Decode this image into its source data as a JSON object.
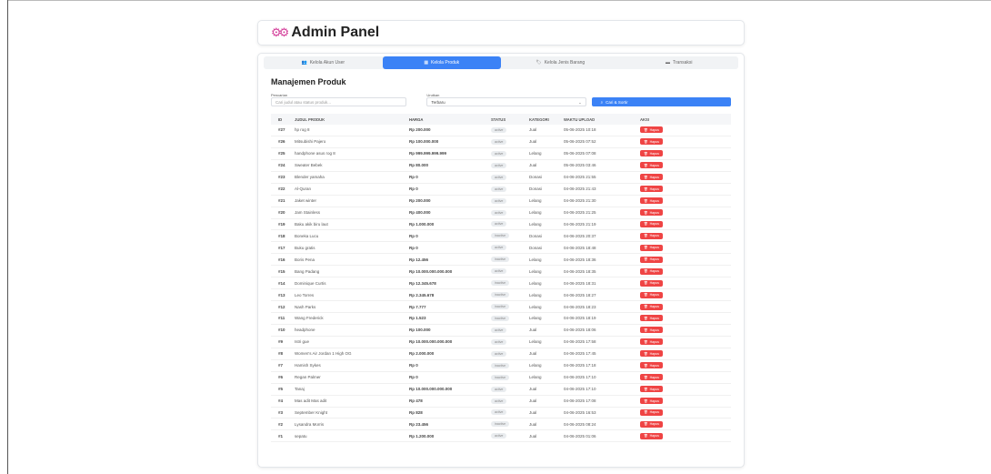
{
  "app": {
    "title": "Admin Panel",
    "icon": "gears-icon",
    "accent_color": "#3b82f6",
    "danger_color": "#ef4444"
  },
  "tabs": [
    {
      "label": "Kelola Akun User",
      "icon": "users-icon",
      "active": false
    },
    {
      "label": "Kelola Produk",
      "icon": "box-icon",
      "active": true
    },
    {
      "label": "Kelola Jenis Barang",
      "icon": "tags-icon",
      "active": false
    },
    {
      "label": "Transaksi",
      "icon": "card-icon",
      "active": false
    }
  ],
  "section_title": "Manajemen Produk",
  "filters": {
    "search_label": "Pencarian",
    "search_placeholder": "Cari judul atau status produk...",
    "sort_label": "Urutkan",
    "sort_value": "Terbaru",
    "submit_label": "Cari & Sortir"
  },
  "table": {
    "headers": [
      "ID",
      "JUDUL PRODUK",
      "HARGA",
      "STATUS",
      "KATEGORI",
      "WAKTU UPLOAD",
      "AKSI"
    ],
    "delete_label": "Hapus",
    "rows": [
      {
        "id": "#27",
        "title": "hp rog 8",
        "price": "Rp 200.000",
        "status": "active",
        "category": "Jual",
        "time": "05-06-2025 10:18"
      },
      {
        "id": "#26",
        "title": "Mitsubishi Pajero",
        "price": "Rp 100.000.000",
        "status": "active",
        "category": "Jual",
        "time": "05-06-2025 07:52"
      },
      {
        "id": "#25",
        "title": "handphone asus rog 8",
        "price": "Rp 999.999.999.999",
        "status": "active",
        "category": "Lelang",
        "time": "05-06-2025 07:08"
      },
      {
        "id": "#24",
        "title": "Sweater Bebek",
        "price": "Rp 80.000",
        "status": "active",
        "category": "Jual",
        "time": "05-06-2025 03:46"
      },
      {
        "id": "#23",
        "title": "Blender yamaha",
        "price": "Rp 0",
        "status": "active",
        "category": "Donasi",
        "time": "04-06-2025 21:55"
      },
      {
        "id": "#22",
        "title": "Al-Quran",
        "price": "Rp 0",
        "status": "active",
        "category": "Donasi",
        "time": "04-06-2025 21:43"
      },
      {
        "id": "#21",
        "title": "Jaket winter",
        "price": "Rp 200.000",
        "status": "active",
        "category": "Lelang",
        "time": "04-06-2025 21:30"
      },
      {
        "id": "#20",
        "title": "Jam Stainless",
        "price": "Rp 400.000",
        "status": "active",
        "category": "Lelang",
        "time": "04-06-2025 21:25"
      },
      {
        "id": "#19",
        "title": "Baku akik biru laut",
        "price": "Rp 1.000.000",
        "status": "active",
        "category": "Lelang",
        "time": "04-06-2025 21:19"
      },
      {
        "id": "#18",
        "title": "Boneka Lucu",
        "price": "Rp 0",
        "status": "inactive",
        "category": "Donasi",
        "time": "04-06-2025 20:37"
      },
      {
        "id": "#17",
        "title": "Buku gratis",
        "price": "Rp 0",
        "status": "active",
        "category": "Donasi",
        "time": "04-06-2025 18:48"
      },
      {
        "id": "#16",
        "title": "Boris Pena",
        "price": "Rp 12.456",
        "status": "inactive",
        "category": "Lelang",
        "time": "04-06-2025 18:36"
      },
      {
        "id": "#15",
        "title": "Bang Padang",
        "price": "Rp 10.000.000.000.000",
        "status": "active",
        "category": "Lelang",
        "time": "04-06-2025 18:35"
      },
      {
        "id": "#14",
        "title": "Dominique Curtis",
        "price": "Rp 12.345.678",
        "status": "inactive",
        "category": "Lelang",
        "time": "04-06-2025 18:31"
      },
      {
        "id": "#13",
        "title": "Leo Torres",
        "price": "Rp 2.345.678",
        "status": "inactive",
        "category": "Lelang",
        "time": "04-06-2025 18:27"
      },
      {
        "id": "#12",
        "title": "Nash Parks",
        "price": "Rp 7.777",
        "status": "inactive",
        "category": "Lelang",
        "time": "04-06-2025 18:23"
      },
      {
        "id": "#11",
        "title": "Wang Frederick",
        "price": "Rp 1.523",
        "status": "inactive",
        "category": "Lelang",
        "time": "04-06-2025 18:19"
      },
      {
        "id": "#10",
        "title": "headphone",
        "price": "Rp 100.000",
        "status": "active",
        "category": "Jual",
        "time": "04-06-2025 18:06"
      },
      {
        "id": "#9",
        "title": "Istri gue",
        "price": "Rp 10.000.000.000.000",
        "status": "active",
        "category": "Lelang",
        "time": "04-06-2025 17:58"
      },
      {
        "id": "#8",
        "title": "Women's Air Jordan 1 High OG",
        "price": "Rp 2.000.000",
        "status": "active",
        "category": "Jual",
        "time": "04-06-2025 17:45"
      },
      {
        "id": "#7",
        "title": "Hamish Sykes",
        "price": "Rp 0",
        "status": "inactive",
        "category": "Lelang",
        "time": "04-06-2025 17:18"
      },
      {
        "id": "#6",
        "title": "Regan Palmer",
        "price": "Rp 0",
        "status": "inactive",
        "category": "Lelang",
        "time": "04-06-2025 17:10"
      },
      {
        "id": "#5",
        "title": "Tanaj",
        "price": "Rp 10.000.000.000.000",
        "status": "active",
        "category": "Jual",
        "time": "04-06-2025 17:10"
      },
      {
        "id": "#4",
        "title": "Mas adit Mas adit",
        "price": "Rp 478",
        "status": "active",
        "category": "Jual",
        "time": "04-06-2025 17:08"
      },
      {
        "id": "#3",
        "title": "September Knight",
        "price": "Rp 828",
        "status": "active",
        "category": "Jual",
        "time": "04-06-2025 16:53"
      },
      {
        "id": "#2",
        "title": "Lysandra Morris",
        "price": "Rp 23.456",
        "status": "inactive",
        "category": "Jual",
        "time": "04-06-2025 08:24"
      },
      {
        "id": "#1",
        "title": "sepatu",
        "price": "Rp 1.200.000",
        "status": "active",
        "category": "Jual",
        "time": "04-06-2025 01:06"
      }
    ]
  }
}
